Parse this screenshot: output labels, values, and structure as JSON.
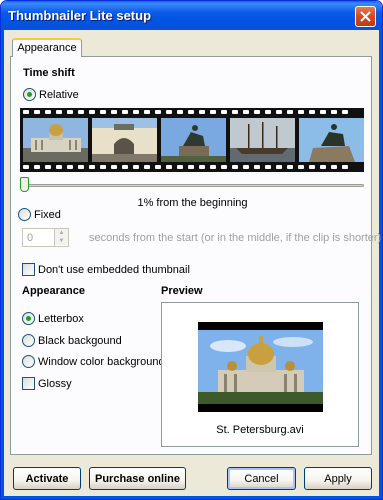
{
  "window": {
    "title": "Thumbnailer Lite setup"
  },
  "tabs": [
    {
      "label": "Appearance"
    }
  ],
  "time_shift": {
    "heading": "Time shift",
    "relative_label": "Relative",
    "relative_checked": true,
    "slider_caption": "1% from the beginning",
    "slider_percent": 1,
    "fixed_label": "Fixed",
    "fixed_checked": false,
    "seconds_value": "0",
    "seconds_caption": "seconds from the start (or in the middle, if the clip is shorter)"
  },
  "embedded": {
    "label": "Don't use embedded thumbnail",
    "checked": false
  },
  "appearance": {
    "heading": "Appearance",
    "options": [
      {
        "label": "Letterbox",
        "checked": true
      },
      {
        "label": "Black backgound",
        "checked": false
      },
      {
        "label": "Window color background",
        "checked": false
      }
    ],
    "glossy": {
      "label": "Glossy",
      "checked": false
    }
  },
  "preview": {
    "heading": "Preview",
    "filename": "St. Petersburg.avi"
  },
  "buttons": {
    "activate": "Activate",
    "purchase": "Purchase online",
    "cancel": "Cancel",
    "apply": "Apply"
  },
  "colors": {
    "title_bar": "#0054e3",
    "radio_dot": "#21a121",
    "tab_highlight": "#ffc83c"
  },
  "icons": {
    "close": "close-icon"
  }
}
